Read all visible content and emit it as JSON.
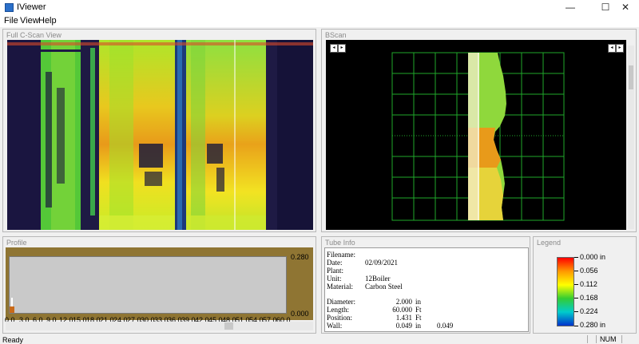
{
  "window": {
    "title": "IViewer",
    "minimize_glyph": "—",
    "maximize_glyph": "☐",
    "close_glyph": "✕"
  },
  "menu": {
    "items": [
      "File",
      "View",
      "Help"
    ]
  },
  "panels": {
    "cscan": {
      "title": "Full C-Scan View"
    },
    "bscan": {
      "title": "BScan",
      "nav_left": "◂ ▸",
      "nav_right": "◂ ▸"
    },
    "profile": {
      "title": "Profile",
      "y_max": "0.280",
      "y_min": "0.000",
      "x_ticks": [
        "0.0",
        "3.0",
        "6.0",
        "9.0",
        "12.0",
        "15.0",
        "18.0",
        "21.0",
        "24.0",
        "27.0",
        "30.0",
        "33.0",
        "36.0",
        "39.0",
        "42.0",
        "45.0",
        "48.0",
        "51.0",
        "54.0",
        "57.0",
        "60.0"
      ]
    },
    "tube_info": {
      "title": "Tube Info",
      "filename_label": "Filename:",
      "filename": "",
      "date_label": "Date:",
      "date": "02/09/2021",
      "plant_label": "Plant:",
      "plant": "",
      "unit_label": "Unit:",
      "unit": "12Boiler",
      "material_label": "Material:",
      "material": "Carbon Steel",
      "diameter_label": "Diameter:",
      "diameter": "2.000",
      "diameter_unit": "in",
      "length_label": "Length:",
      "length": "60.000",
      "length_unit": "Ft",
      "position_label": "Position:",
      "position": "1.431",
      "position_unit": "Ft",
      "wall_label": "Wall:",
      "wall": "0.049",
      "wall_unit": "in",
      "wall_extra": "0.049"
    },
    "legend": {
      "title": "Legend",
      "labels": [
        "0.000 in",
        "0.056",
        "0.112",
        "0.168",
        "0.224",
        "0.280 in"
      ]
    }
  },
  "status": {
    "text": "Ready",
    "num": "NUM"
  }
}
